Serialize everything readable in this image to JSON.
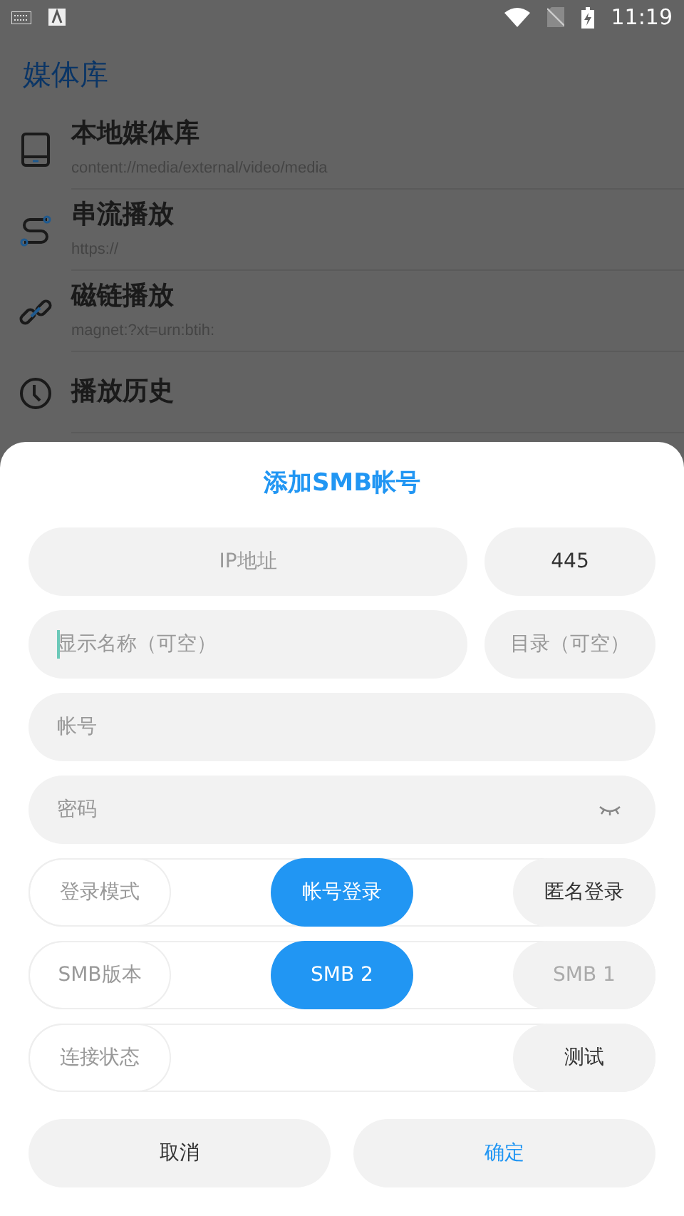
{
  "status_bar": {
    "time": "11:19"
  },
  "app_bar": {
    "title": "媒体库"
  },
  "library": [
    {
      "kind": "device",
      "title": "本地媒体库",
      "subtitle": "content://media/external/video/media"
    },
    {
      "kind": "stream",
      "title": "串流播放",
      "subtitle": "https://"
    },
    {
      "kind": "link",
      "title": "磁链播放",
      "subtitle": "magnet:?xt=urn:btih:"
    },
    {
      "kind": "history",
      "title": "播放历史"
    }
  ],
  "dialog": {
    "title": "添加SMB帐号",
    "ip": {
      "placeholder": "IP地址"
    },
    "port": {
      "value": "445"
    },
    "display_name": {
      "placeholder": "显示名称（可空）",
      "focused": true
    },
    "directory": {
      "placeholder": "目录（可空）"
    },
    "account": {
      "placeholder": "帐号"
    },
    "password": {
      "placeholder": "密码",
      "visible": false
    },
    "options": [
      {
        "label": "登录模式",
        "choices": [
          {
            "label": "帐号登录",
            "selected": true,
            "disabled": false
          },
          {
            "label": "匿名登录",
            "selected": false,
            "disabled": false
          }
        ]
      },
      {
        "label": "SMB版本",
        "choices": [
          {
            "label": "SMB 2",
            "selected": true,
            "disabled": false
          },
          {
            "label": "SMB 1",
            "selected": false,
            "disabled": true
          }
        ]
      }
    ],
    "connection": {
      "label": "连接状态",
      "button": "测试"
    },
    "buttons": [
      {
        "kind": "cancel",
        "label": "取消"
      },
      {
        "kind": "confirm",
        "label": "确定"
      }
    ]
  }
}
